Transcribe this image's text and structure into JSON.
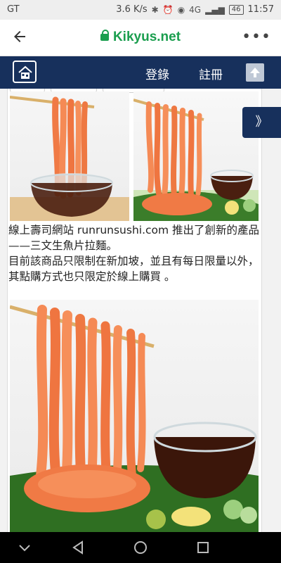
{
  "status_bar": {
    "carrier": "GT",
    "speed": "3.6 K/s",
    "icons": [
      "bluetooth-icon",
      "alarm-icon",
      "eye-icon",
      "signal-icon",
      "battery-icon"
    ],
    "network": "4G",
    "battery": "46",
    "time": "11:57"
  },
  "browser": {
    "domain": "Kikyus.net",
    "menu_glyph": "•••"
  },
  "site_nav": {
    "login_label": "登錄",
    "register_label": "註冊",
    "brand_color": "#17305c"
  },
  "side_button": {
    "glyph": "》"
  },
  "article": {
    "paragraph1": "線上壽司網站 runrunsushi.com 推出了創新的產品——三文生魚片拉麵。",
    "paragraph2": "目前該商品只限制在新加坡，並且有每日限量以外，其點購方式也只限定於線上購買 。"
  },
  "images": [
    {
      "name": "salmon-noodle-dipping-image",
      "desc_icon": "salmon-noodles-in-sauce"
    },
    {
      "name": "salmon-noodle-plate-image",
      "desc_icon": "salmon-noodles-on-leaf"
    },
    {
      "name": "salmon-noodle-large-image",
      "desc_icon": "salmon-noodles-with-sauce-bowl"
    }
  ]
}
